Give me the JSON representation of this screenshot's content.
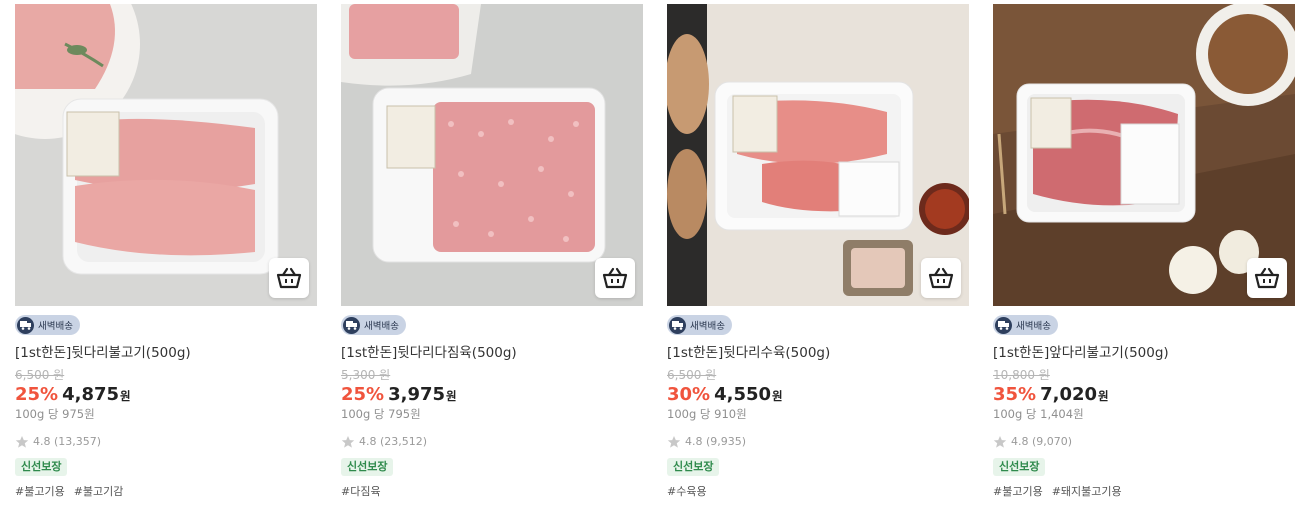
{
  "products": [
    {
      "badge": "새벽배송",
      "name": "[1st한돈]뒷다리불고기(500g)",
      "original_price": "6,500 원",
      "discount": "25%",
      "price": "4,875",
      "currency": "원",
      "unit_price": "100g 당 975원",
      "rating": "4.8 (13,357)",
      "fresh_badge": "신선보장",
      "tags": [
        "#불고기용",
        "#불고기감"
      ]
    },
    {
      "badge": "새벽배송",
      "name": "[1st한돈]뒷다리다짐육(500g)",
      "original_price": "5,300 원",
      "discount": "25%",
      "price": "3,975",
      "currency": "원",
      "unit_price": "100g 당 795원",
      "rating": "4.8 (23,512)",
      "fresh_badge": "신선보장",
      "tags": [
        "#다짐육"
      ]
    },
    {
      "badge": "새벽배송",
      "name": "[1st한돈]뒷다리수육(500g)",
      "original_price": "6,500 원",
      "discount": "30%",
      "price": "4,550",
      "currency": "원",
      "unit_price": "100g 당 910원",
      "rating": "4.8 (9,935)",
      "fresh_badge": "신선보장",
      "tags": [
        "#수육용"
      ]
    },
    {
      "badge": "새벽배송",
      "name": "[1st한돈]앞다리불고기(500g)",
      "original_price": "10,800 원",
      "discount": "35%",
      "price": "7,020",
      "currency": "원",
      "unit_price": "100g 당 1,404원",
      "rating": "4.8 (9,070)",
      "fresh_badge": "신선보장",
      "tags": [
        "#불고기용",
        "#돼지불고기용"
      ]
    }
  ],
  "colors": {
    "discount": "#f0543d",
    "fresh_badge_bg": "#e7f4ea",
    "fresh_badge_text": "#2f8a4c",
    "dawn_badge_bg": "#c9d3e4"
  }
}
